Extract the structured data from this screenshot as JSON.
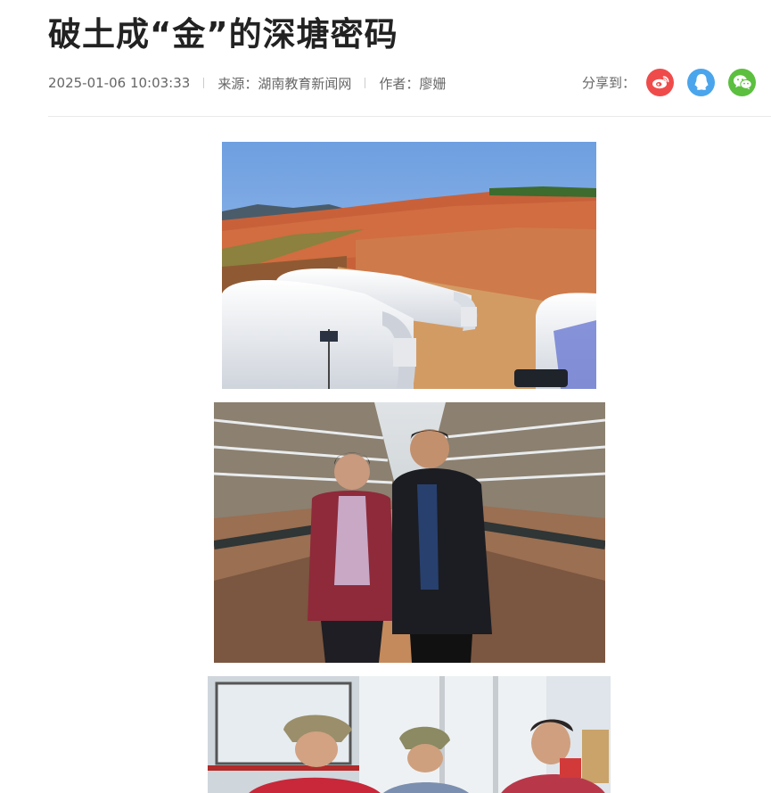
{
  "article": {
    "title": "破土成“金”的深塘密码",
    "date": "2025-01-06 10:03:33",
    "source": "来源：湖南教育新闻网",
    "author": "作者：廖姗"
  },
  "share": {
    "label": "分享到：",
    "buttons": [
      {
        "icon": "weibo-icon",
        "color": "#f04b4b"
      },
      {
        "icon": "qq-icon",
        "color": "#4aa5ec"
      },
      {
        "icon": "wechat-icon",
        "color": "#5cbf3f"
      }
    ]
  },
  "photos": [
    {
      "subject": "greenhouses-on-red-hillside"
    },
    {
      "subject": "two-people-inspecting-fungus-in-greenhouse"
    },
    {
      "subject": "three-women-working-in-greenhouse"
    }
  ]
}
